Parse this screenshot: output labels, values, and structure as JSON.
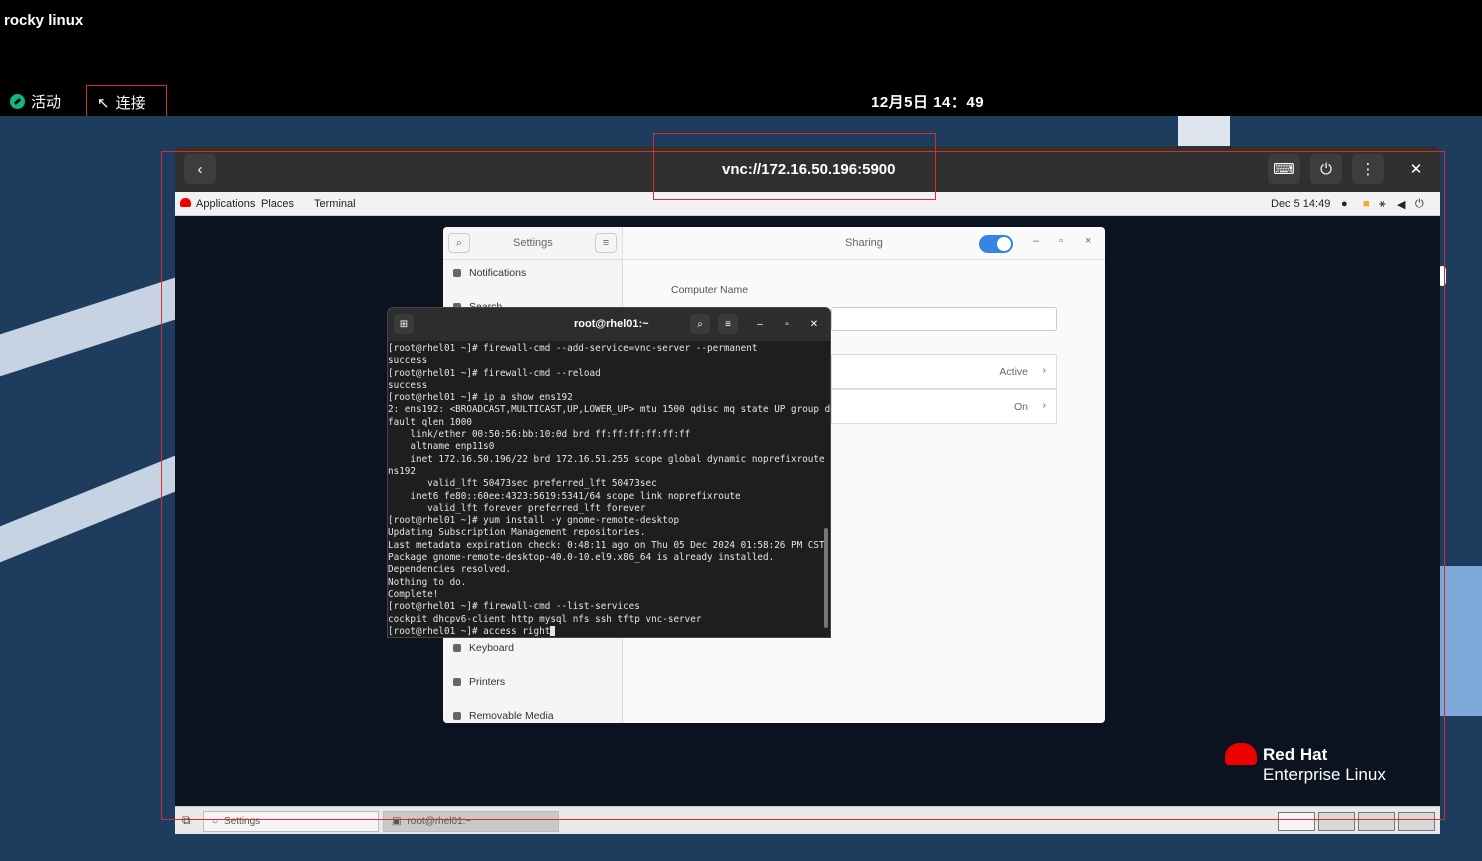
{
  "host": {
    "title": "rocky linux"
  },
  "gnome_bar": {
    "activities": "活动",
    "connect": "连接",
    "clock": "12月5日 14：49"
  },
  "vnc": {
    "url": "vnc://172.16.50.196:5900",
    "back_icon": "‹",
    "keyboard_icon": "⌨",
    "power_icon": "⏻",
    "menu_icon": "⋮",
    "close_icon": "✕"
  },
  "rh_panel": {
    "applications": "Applications",
    "places": "Places",
    "terminal": "Terminal",
    "clock": "Dec 5 14:49"
  },
  "settings": {
    "title": "Settings",
    "page": "Sharing",
    "sidebar": [
      "Notifications",
      "Search",
      "Keyboard",
      "Printers",
      "Removable Media"
    ],
    "computer_name_label": "Computer Name",
    "rows": [
      {
        "status": "Active"
      },
      {
        "status": "On"
      }
    ]
  },
  "terminal": {
    "title": "root@rhel01:~",
    "lines": [
      "[root@rhel01 ~]# firewall-cmd --add-service=vnc-server --permanent",
      "success",
      "[root@rhel01 ~]# firewall-cmd --reload",
      "success",
      "[root@rhel01 ~]# ip a show ens192",
      "2: ens192: <BROADCAST,MULTICAST,UP,LOWER_UP> mtu 1500 qdisc mq state UP group de",
      "fault qlen 1000",
      "    link/ether 00:50:56:bb:10:0d brd ff:ff:ff:ff:ff:ff",
      "    altname enp11s0",
      "    inet 172.16.50.196/22 brd 172.16.51.255 scope global dynamic noprefixroute e",
      "ns192",
      "       valid_lft 50473sec preferred_lft 50473sec",
      "    inet6 fe80::60ee:4323:5619:5341/64 scope link noprefixroute",
      "       valid_lft forever preferred_lft forever",
      "[root@rhel01 ~]# yum install -y gnome-remote-desktop",
      "Updating Subscription Management repositories.",
      "Last metadata expiration check: 0:48:11 ago on Thu 05 Dec 2024 01:58:26 PM CST.",
      "Package gnome-remote-desktop-40.0-10.el9.x86_64 is already installed.",
      "Dependencies resolved.",
      "Nothing to do.",
      "Complete!",
      "[root@rhel01 ~]# firewall-cmd --list-services",
      "cockpit dhcpv6-client http mysql nfs ssh tftp vnc-server",
      "[root@rhel01 ~]# access right"
    ]
  },
  "brand": {
    "line1": "Red Hat",
    "line2": "Enterprise Linux"
  },
  "taskbar": {
    "settings": "Settings",
    "terminal": "root@rhel01:~"
  }
}
